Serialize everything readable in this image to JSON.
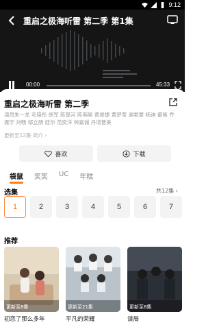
{
  "status_bar": {
    "time": "9:12"
  },
  "player": {
    "title": "重启之极海听雷 第二季 第1集",
    "current_time": "00:00",
    "total_time": "45:33",
    "progress": 0
  },
  "show": {
    "title": "重启之极海听雷 第二季",
    "cast": "演员朱一龙 毛晓彤 胡军 陈楚河 陈明昊 黄俊捷 黄梦莹 谢君豪 杨迪 蕾晰 乔振宇 刘畅 邬立朋 娃尔 范奕洋 钟嘉诚 丹增普美",
    "update_info": "更新至12集·简介 ›"
  },
  "actions": {
    "like_label": "喜欢",
    "download_label": "下载"
  },
  "tabs": [
    "袋鼠",
    "笑笑",
    "UC",
    "年糕"
  ],
  "episodes": {
    "heading": "选集",
    "count_label": "共12集 ›",
    "items": [
      "1",
      "2",
      "3",
      "4",
      "5",
      "6",
      "7"
    ]
  },
  "recommend": {
    "heading": "推荐",
    "items": [
      {
        "badge": "更新至8集",
        "title": "初恋了那么多年"
      },
      {
        "badge": "更新至21集",
        "title": "平凡的荣耀"
      },
      {
        "badge": "更新至8集",
        "title": "谍局"
      }
    ]
  }
}
